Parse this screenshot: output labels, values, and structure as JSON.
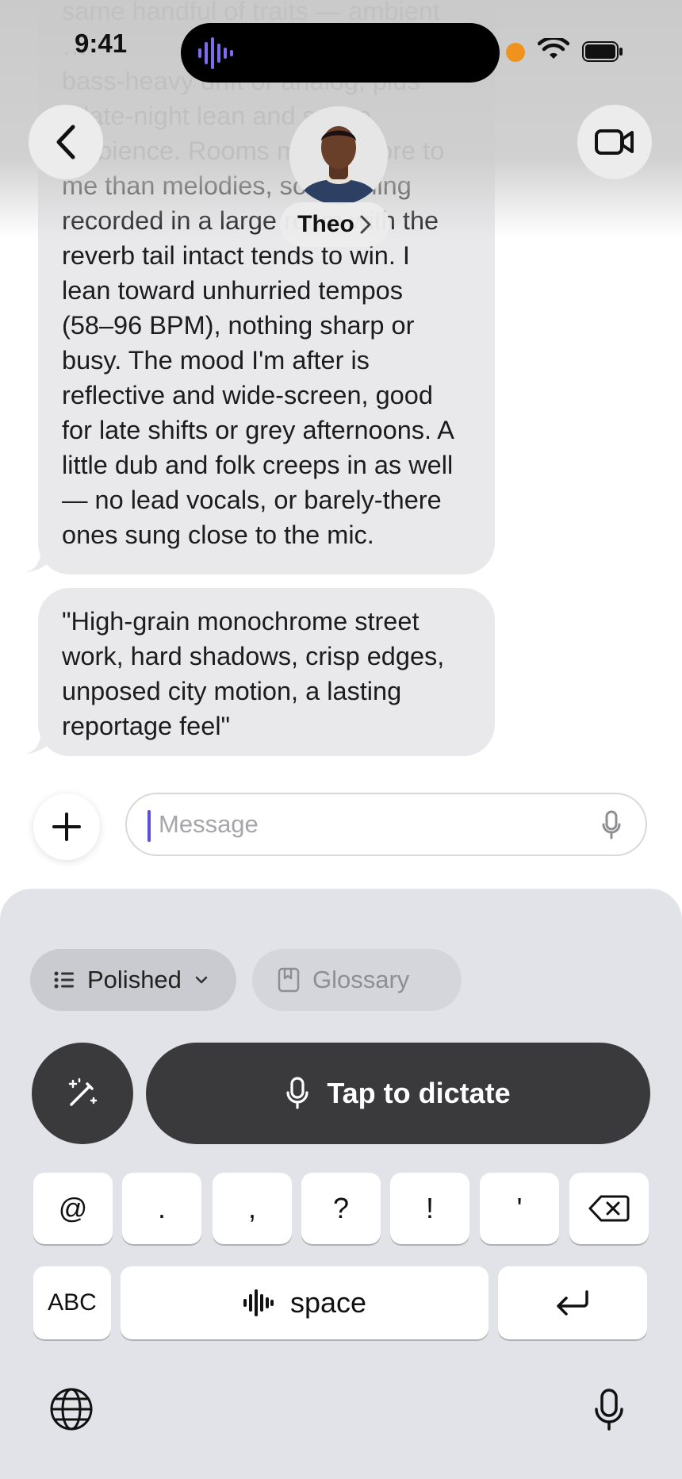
{
  "status_bar": {
    "time": "9:41"
  },
  "contact": {
    "name": "Theo"
  },
  "messages": [
    {
      "text": "same handful of traits — ambient\n…\nbass-heavy drift or analog, plus\na late-night lean and space\nambience. Rooms matter more to\nme than melodies, so anything\nrecorded in a large room with the\nreverb tail intact tends to win. I\nlean toward unhurried tempos\n(58–96 BPM), nothing sharp or\nbusy. The mood I'm after is\nreflective and wide-screen, good\nfor late shifts or grey afternoons. A\nlittle dub and folk creeps in as well\n— no lead vocals, or barely-there\nones sung close to the mic."
    },
    {
      "text": "\"High-grain monochrome street\nwork, hard shadows, crisp edges,\nunposed city motion, a lasting\nreportage feel\""
    }
  ],
  "composer": {
    "placeholder": "Message"
  },
  "keyboard": {
    "mode_label": "Polished",
    "glossary_label": "Glossary",
    "dictate_label": "Tap to dictate",
    "punct_keys": [
      "@",
      ".",
      ",",
      "?",
      "!",
      "'"
    ],
    "abc_label": "ABC",
    "space_label": "space"
  },
  "colors": {
    "accent": "#5a4fd9",
    "bubble": "#e9e9eb",
    "keyboard_bg": "#e2e3e8",
    "dark_button": "#3a3a3c"
  },
  "icons": [
    "back-chevron-icon",
    "video-camera-icon",
    "plus-icon",
    "microphone-icon",
    "list-icon",
    "chevron-down-icon",
    "book-icon",
    "magic-wand-icon",
    "backspace-icon",
    "waveform-icon",
    "return-icon",
    "globe-icon"
  ]
}
